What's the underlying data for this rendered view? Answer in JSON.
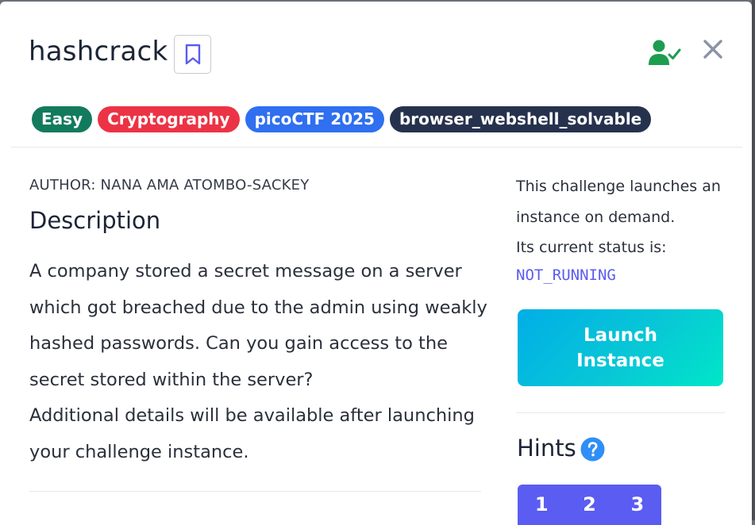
{
  "challenge": {
    "title": "hashcrack",
    "tags": [
      {
        "label": "Easy",
        "color": "#127a5d"
      },
      {
        "label": "Cryptography",
        "color": "#ec3345"
      },
      {
        "label": "picoCTF 2025",
        "color": "#2f6ff0"
      },
      {
        "label": "browser_webshell_solvable",
        "color": "#26324d"
      }
    ],
    "author": "AUTHOR: NANA AMA ATOMBO-SACKEY",
    "description_heading": "Description",
    "description_paragraphs": [
      "A company stored a secret message on a server which got breached due to the admin using weakly hashed passwords. Can you gain access to the secret stored within the server?",
      "Additional details will be available after launching your challenge instance."
    ]
  },
  "instance": {
    "info_line1": "This challenge launches an instance on demand.",
    "info_line2": "Its current status is:",
    "status": "NOT_RUNNING",
    "launch_label": "Launch Instance"
  },
  "hints": {
    "heading": "Hints",
    "tabs": [
      "1",
      "2",
      "3"
    ]
  },
  "icons": {
    "bookmark": "bookmark-icon",
    "user_status": "user-check-icon",
    "close": "close-icon",
    "help": "question-circle-icon"
  },
  "colors": {
    "accent": "#5a5cf0",
    "success_green": "#1d9d4f",
    "hint_tab_bg": "#5b5cf2"
  }
}
